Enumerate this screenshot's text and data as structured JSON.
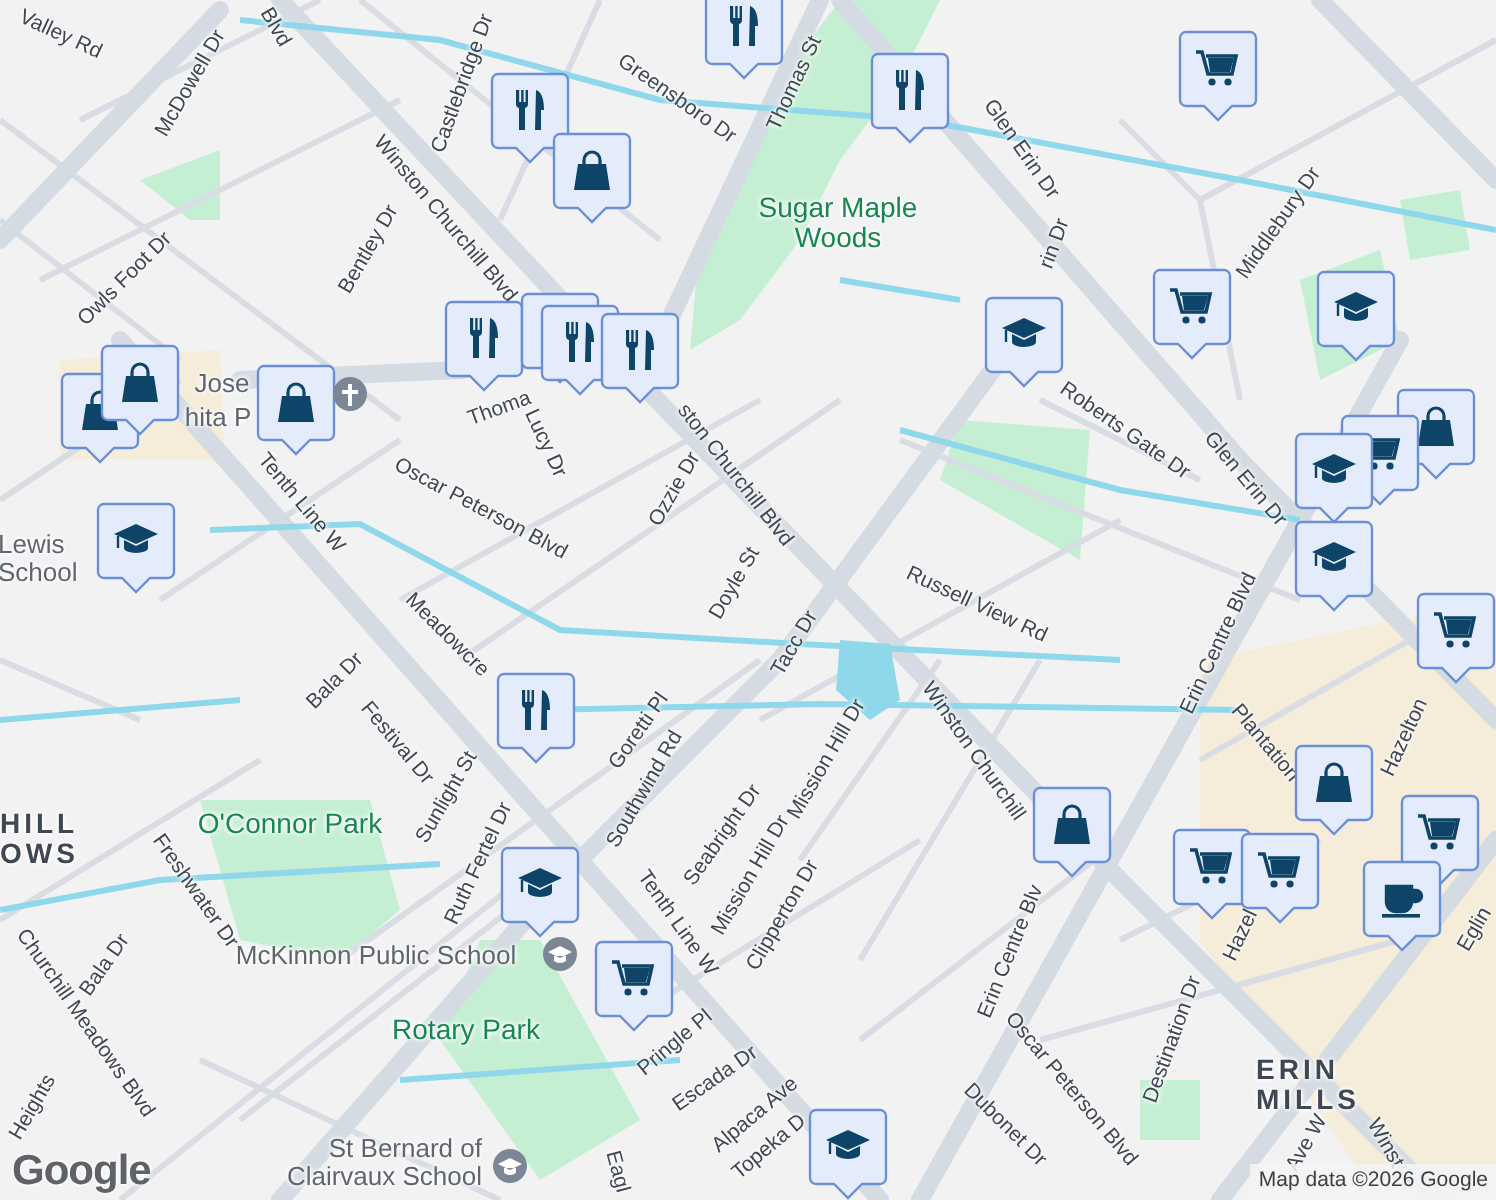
{
  "map": {
    "labels": [
      {
        "kind": "street",
        "text": "Valley Rd"
      },
      {
        "kind": "street",
        "text": "McDowell Dr"
      },
      {
        "kind": "street",
        "text": "Blvd"
      },
      {
        "kind": "street",
        "text": "Castlebridge Dr"
      },
      {
        "kind": "street",
        "text": "Greensboro Dr"
      },
      {
        "kind": "street",
        "text": "Winston Churchill Blvd"
      },
      {
        "kind": "street",
        "text": "Bentley Dr"
      },
      {
        "kind": "street",
        "text": "Owls Foot Dr"
      },
      {
        "kind": "street",
        "text": "Thomas St"
      },
      {
        "kind": "street",
        "text": "Glen Erin Dr"
      },
      {
        "kind": "park",
        "text": "Sugar Maple Woods"
      },
      {
        "kind": "street",
        "text": "rin Dr"
      },
      {
        "kind": "street",
        "text": "Roberts Gate Dr"
      },
      {
        "kind": "street",
        "text": "Middlebury Dr"
      },
      {
        "kind": "street",
        "text": "Glen Erin Dr"
      },
      {
        "kind": "street",
        "text": "Thoma"
      },
      {
        "kind": "place",
        "text": "Jose"
      },
      {
        "kind": "place",
        "text": "hita P"
      },
      {
        "kind": "street",
        "text": "Lucy Dr"
      },
      {
        "kind": "street",
        "text": "Oscar Peterson Blvd"
      },
      {
        "kind": "street",
        "text": "Ozzie Dr"
      },
      {
        "kind": "street",
        "text": "Doyle St"
      },
      {
        "kind": "street",
        "text": "ston Churchill Blvd"
      },
      {
        "kind": "street",
        "text": "Tenth Line W"
      },
      {
        "kind": "place",
        "text": "Lewis School"
      },
      {
        "kind": "street",
        "text": "Russell View Rd"
      },
      {
        "kind": "street",
        "text": "Tacc Dr"
      },
      {
        "kind": "street",
        "text": "Winston Churchill"
      },
      {
        "kind": "street",
        "text": "Erin Centre Blvd"
      },
      {
        "kind": "street",
        "text": "Plantation"
      },
      {
        "kind": "street",
        "text": "Hazelton"
      },
      {
        "kind": "street",
        "text": "Meadowcre"
      },
      {
        "kind": "street",
        "text": "Bala Dr"
      },
      {
        "kind": "street",
        "text": "Festival Dr"
      },
      {
        "kind": "street",
        "text": "Sunlight St"
      },
      {
        "kind": "street",
        "text": "Goretti Pl"
      },
      {
        "kind": "street",
        "text": "Southwind Rd"
      },
      {
        "kind": "street",
        "text": "Seabright Dr"
      },
      {
        "kind": "street",
        "text": "Mission Hill Dr"
      },
      {
        "kind": "street",
        "text": "Mission Hill Dr"
      },
      {
        "kind": "street",
        "text": "Clipperton Dr"
      },
      {
        "kind": "street",
        "text": "Ruth Fertel Dr"
      },
      {
        "kind": "park",
        "text": "O'Connor Park"
      },
      {
        "kind": "district",
        "text": "HILL OWS"
      },
      {
        "kind": "street",
        "text": "Churchill Meadows Blvd"
      },
      {
        "kind": "street",
        "text": "Bala Dr"
      },
      {
        "kind": "street",
        "text": "Freshwater Dr"
      },
      {
        "kind": "place",
        "text": "McKinnon Public School"
      },
      {
        "kind": "park",
        "text": "Rotary Park"
      },
      {
        "kind": "street",
        "text": "Tenth Line W"
      },
      {
        "kind": "street",
        "text": "Pringle Pl"
      },
      {
        "kind": "street",
        "text": "Escada Dr"
      },
      {
        "kind": "street",
        "text": "Alpaca Ave"
      },
      {
        "kind": "street",
        "text": "Topeka D"
      },
      {
        "kind": "street",
        "text": "Eagl"
      },
      {
        "kind": "place",
        "text": "St Bernard of Clairvaux School"
      },
      {
        "kind": "street",
        "text": "Heights"
      },
      {
        "kind": "street",
        "text": "Dubonet Dr"
      },
      {
        "kind": "street",
        "text": "Oscar Peterson Blvd"
      },
      {
        "kind": "street",
        "text": "Erin Centre Blv"
      },
      {
        "kind": "street",
        "text": "Destination Dr"
      },
      {
        "kind": "street",
        "text": "Hazel"
      },
      {
        "kind": "district",
        "text": "ERIN MILLS"
      },
      {
        "kind": "street",
        "text": "Ave W"
      },
      {
        "kind": "street",
        "text": "Winst"
      },
      {
        "kind": "street",
        "text": "Eglin"
      }
    ]
  },
  "logo": "Google",
  "attribution": "Map data ©2026 Google"
}
